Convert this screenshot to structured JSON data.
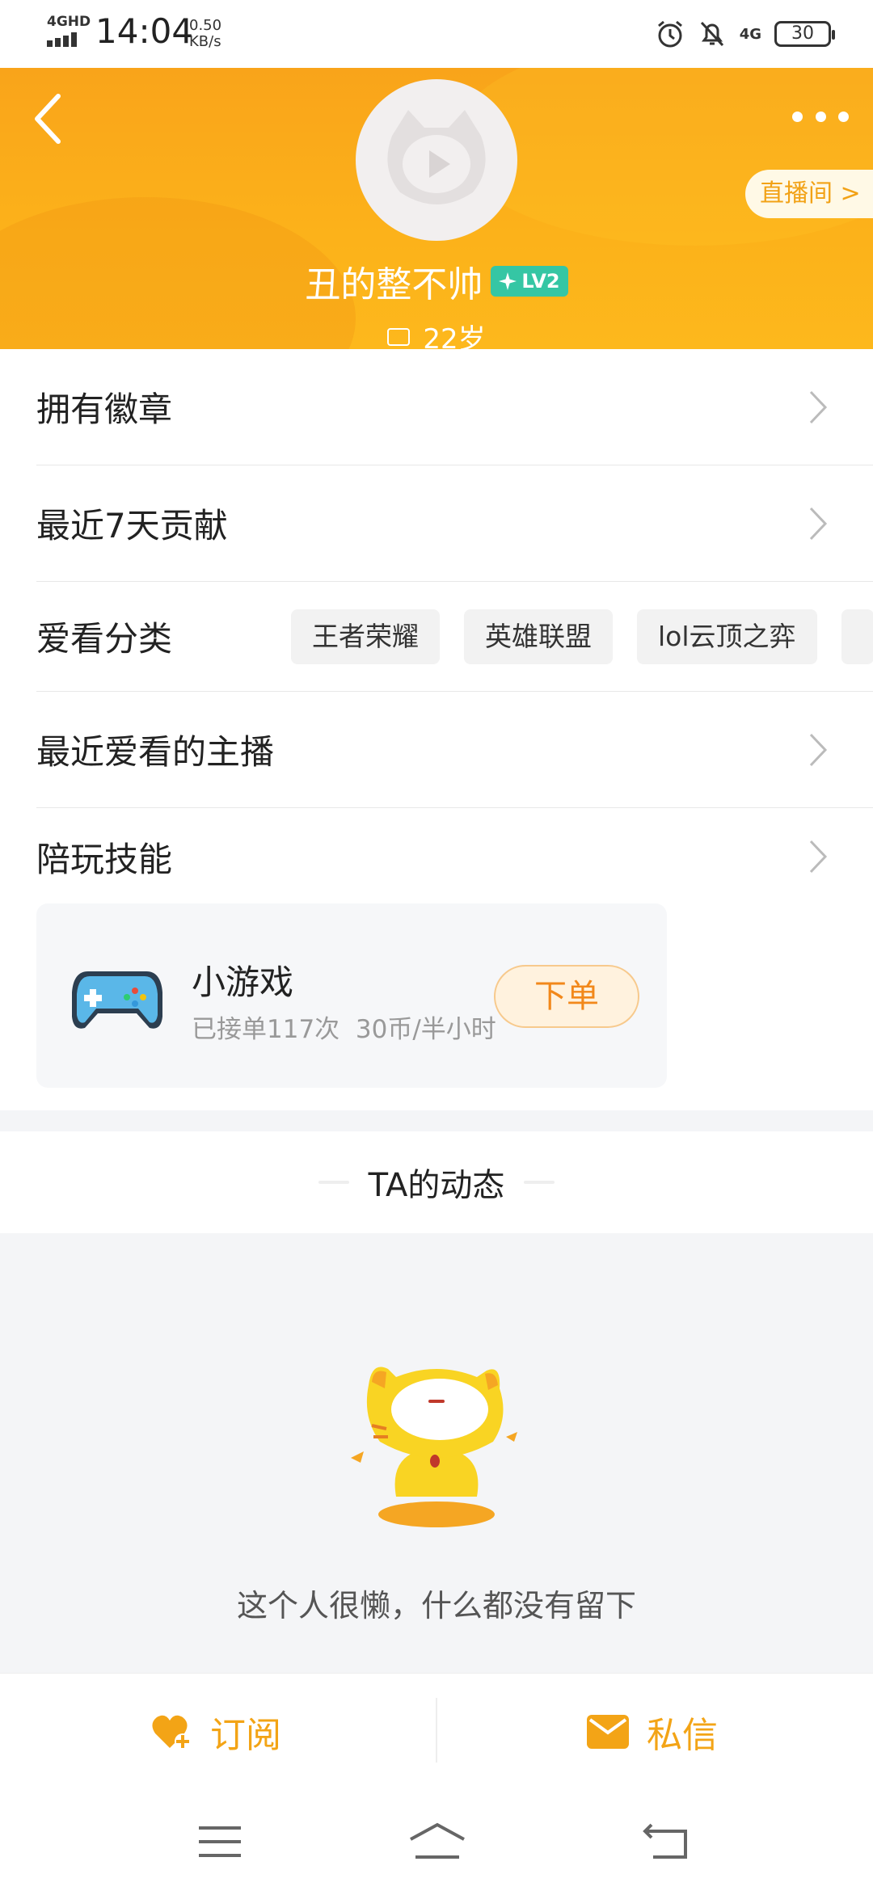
{
  "status_bar": {
    "network": "4GHD",
    "time": "14:04",
    "speed_value": "0.50",
    "speed_unit": "KB/s",
    "signal_label": "4G",
    "battery": "30"
  },
  "header": {
    "live_room_label": "直播间 >",
    "username": "丑的整不帅",
    "level": "LV2",
    "age": "22岁",
    "accent_color": "#fcb21a"
  },
  "menu": {
    "badges": "拥有徽章",
    "contribution": "最近7天贡献",
    "favorite_categories": "爱看分类",
    "favorite_anchors": "最近爱看的主播",
    "play_skills": "陪玩技能"
  },
  "categories": [
    "王者荣耀",
    "英雄联盟",
    "lol云顶之弈"
  ],
  "skill": {
    "title": "小游戏",
    "stats": "已接单117次",
    "price": "30币/半小时",
    "order_button": "下单"
  },
  "feed": {
    "title": "TA的动态",
    "empty_text": "这个人很懒，什么都没有留下"
  },
  "actions": {
    "subscribe": "订阅",
    "message": "私信"
  }
}
